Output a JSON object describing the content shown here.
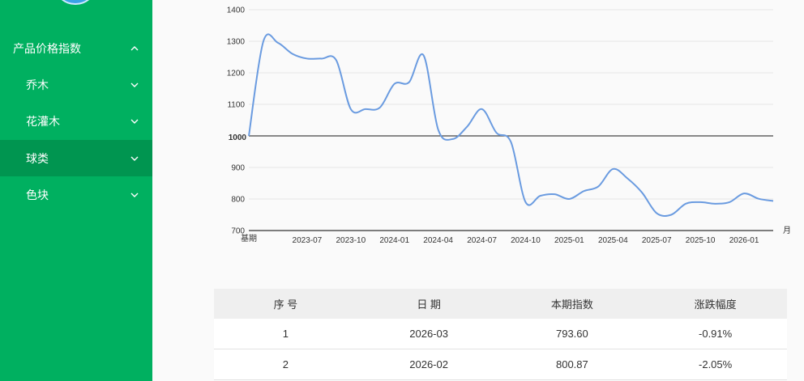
{
  "sidebar": {
    "items": [
      {
        "label": "产品价格指数",
        "expanded": true
      },
      {
        "label": "乔木"
      },
      {
        "label": "花灌木"
      },
      {
        "label": "球类",
        "active": true
      },
      {
        "label": "色块"
      }
    ]
  },
  "chart_data": {
    "type": "line",
    "x_unit": "月",
    "base_label": "基期",
    "x_ticks": [
      "2023-07",
      "2023-10",
      "2024-01",
      "2024-04",
      "2024-07",
      "2024-10",
      "2025-01",
      "2025-04",
      "2025-07",
      "2025-10",
      "2026-01"
    ],
    "y_ticks": [
      700,
      800,
      900,
      1000,
      1100,
      1200,
      1300,
      1400
    ],
    "ylim": [
      700,
      1400
    ],
    "reference_line": 1000,
    "line_color": "#6a9be0",
    "series": [
      {
        "x": [
          "基期",
          "2023-04",
          "2023-05",
          "2023-06",
          "2023-07",
          "2023-08",
          "2023-09",
          "2023-10",
          "2023-11",
          "2023-12",
          "2024-01",
          "2024-02",
          "2024-03",
          "2024-04",
          "2024-05",
          "2024-06",
          "2024-07",
          "2024-08",
          "2024-09",
          "2024-10",
          "2024-11",
          "2024-12",
          "2025-01",
          "2025-02",
          "2025-03",
          "2025-04",
          "2025-05",
          "2025-06",
          "2025-07",
          "2025-08",
          "2025-09",
          "2025-10",
          "2025-11",
          "2025-12",
          "2026-01",
          "2026-02",
          "2026-03"
        ],
        "values": [
          1000,
          1300,
          1295,
          1260,
          1245,
          1245,
          1240,
          1085,
          1085,
          1090,
          1165,
          1170,
          1255,
          1020,
          990,
          1030,
          1085,
          1010,
          980,
          790,
          810,
          815,
          800,
          825,
          840,
          895,
          865,
          820,
          755,
          750,
          785,
          790,
          785,
          790,
          817.6,
          800.87,
          793.6
        ]
      }
    ]
  },
  "table": {
    "headers": [
      "序 号",
      "日 期",
      "本期指数",
      "涨跌幅度"
    ],
    "rows": [
      [
        "1",
        "2026-03",
        "793.60",
        "-0.91%"
      ],
      [
        "2",
        "2026-02",
        "800.87",
        "-2.05%"
      ]
    ]
  }
}
